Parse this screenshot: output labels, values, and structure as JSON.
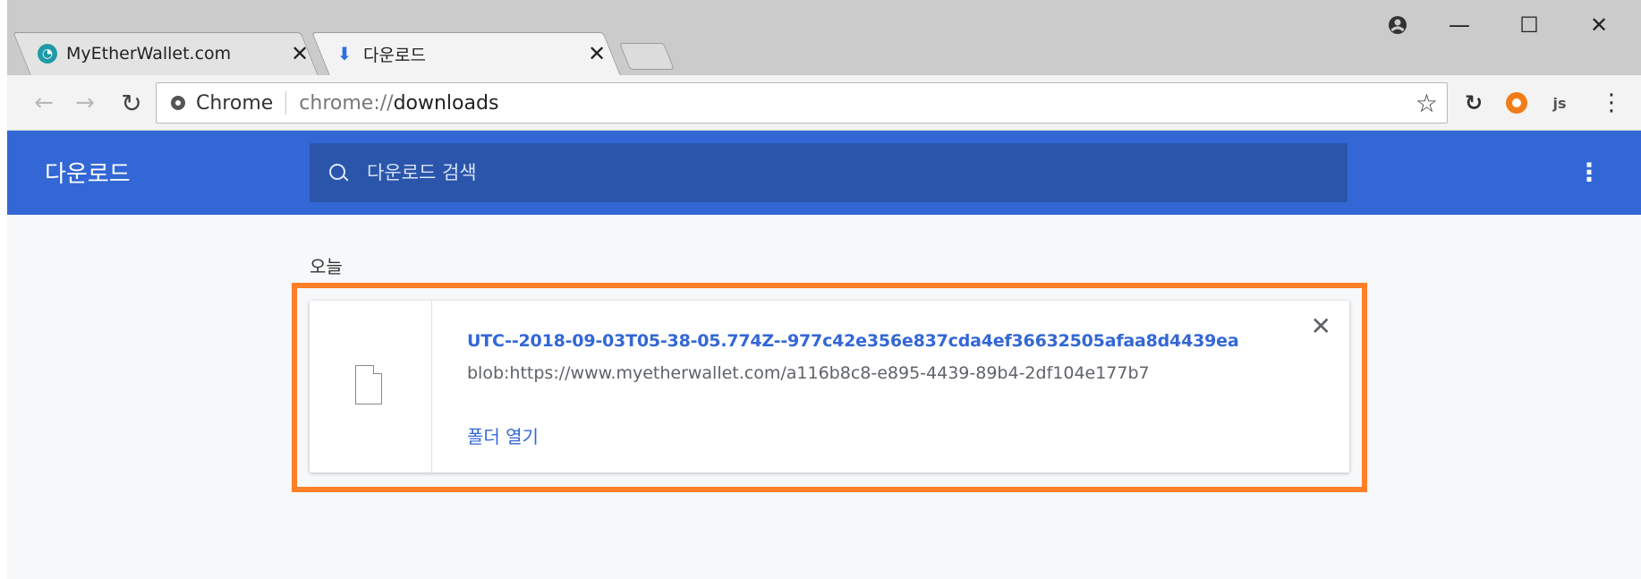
{
  "tabs": [
    {
      "title": "MyEtherWallet.com",
      "favicon": "myetherwallet-icon",
      "close": "✕"
    },
    {
      "title": "다운로드",
      "favicon": "download-icon",
      "close": "✕"
    }
  ],
  "window_controls": {
    "minimize": "—",
    "maximize": "☐",
    "close": "✕"
  },
  "toolbar": {
    "origin_chip": "Chrome",
    "url_scheme": "chrome://",
    "url_path": "downloads"
  },
  "downloads_page": {
    "title": "다운로드",
    "search_placeholder": "다운로드 검색",
    "date_label": "오늘",
    "item": {
      "file_name": "UTC--2018-09-03T05-38-05.774Z--977c42e356e837cda4ef36632505afaa8d4439ea",
      "source_url": "blob:https://www.myetherwallet.com/a116b8c8-e895-4439-89b4-2df104e177b7",
      "action_label": "폴더 열기",
      "remove": "✕"
    }
  },
  "colors": {
    "header_blue": "#3367d6",
    "highlight_orange": "#ff7f27"
  }
}
